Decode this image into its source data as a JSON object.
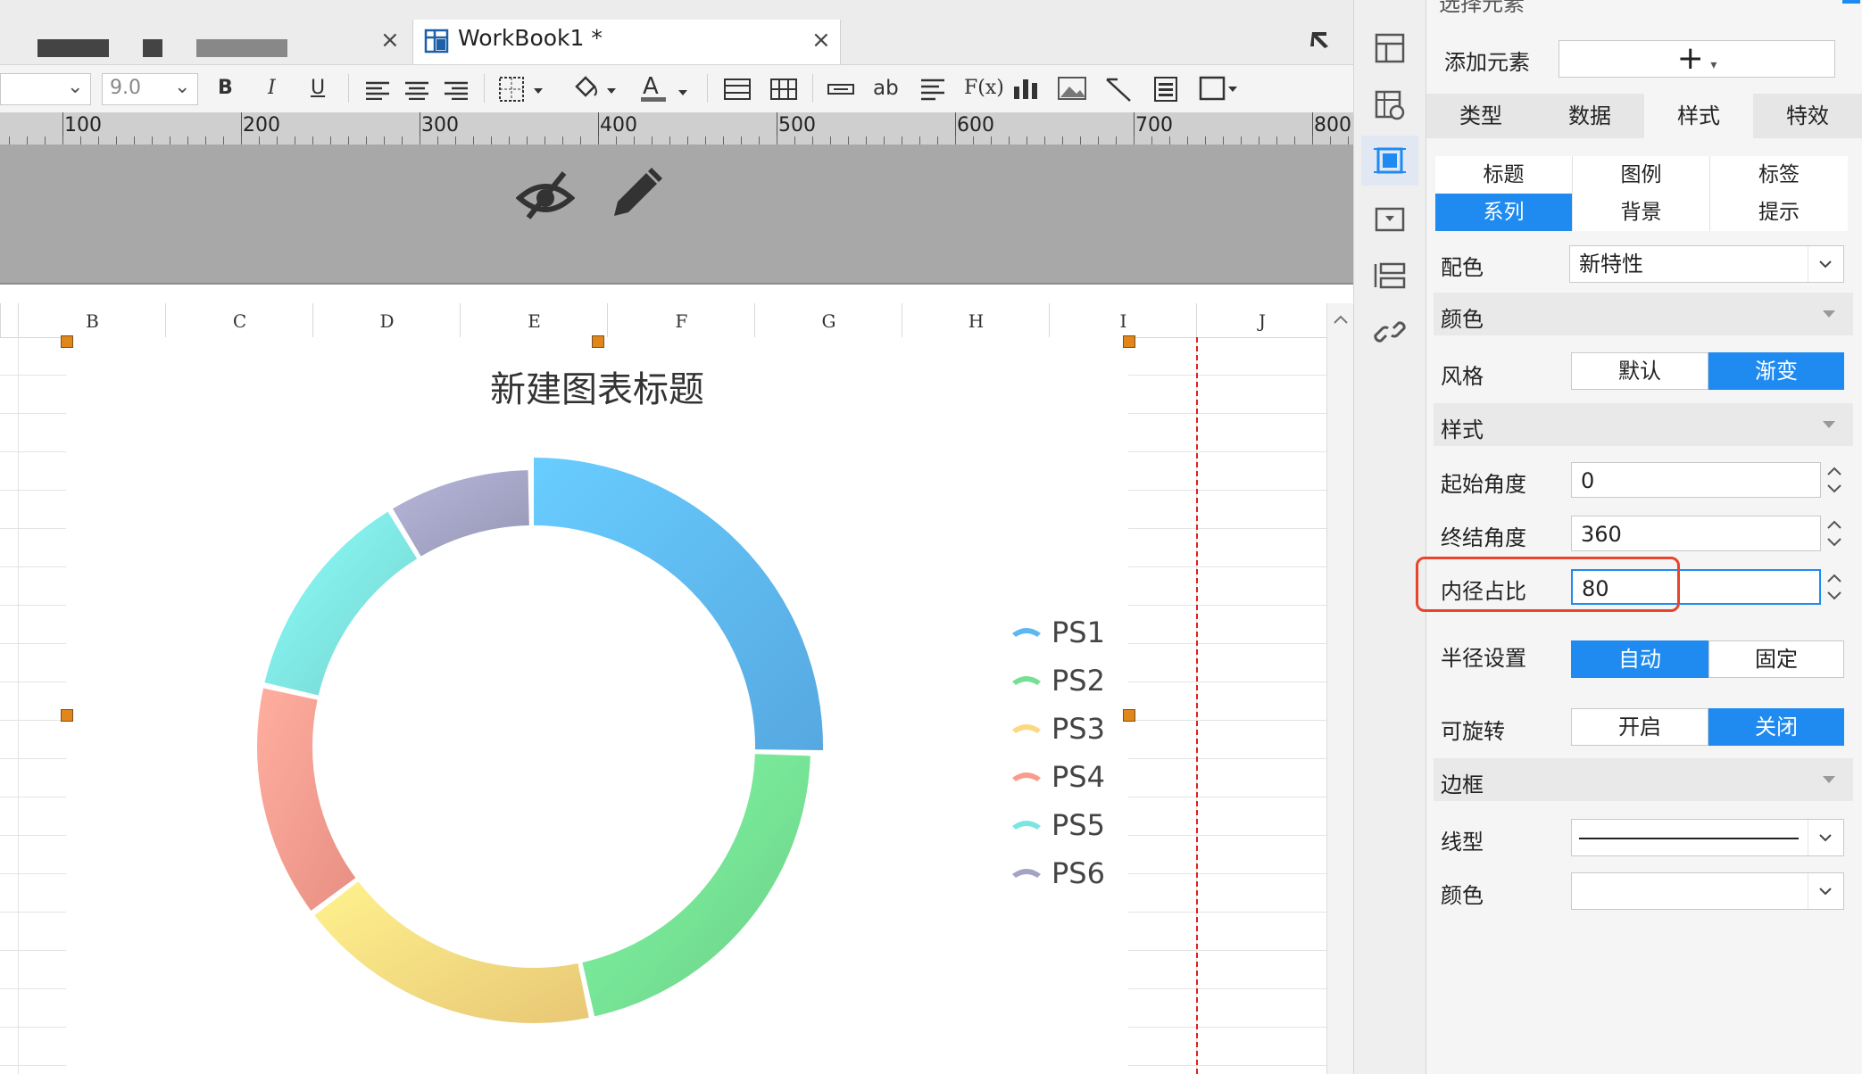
{
  "window": {
    "tabs": [
      {
        "title": "",
        "close": "×"
      },
      {
        "title": "WorkBook1  *",
        "close": "×"
      }
    ]
  },
  "toolbar": {
    "font_size": "9.0",
    "bold": "B",
    "italic": "I",
    "underline": "U",
    "text_btn": "ab",
    "formula_btn": "F(x)"
  },
  "ruler": {
    "labels": [
      "100",
      "200",
      "300",
      "400",
      "500",
      "600",
      "700",
      "800"
    ]
  },
  "sheet": {
    "columns": [
      "B",
      "C",
      "D",
      "E",
      "F",
      "G",
      "H",
      "I",
      "J"
    ]
  },
  "chart": {
    "title": "新建图表标题",
    "legend": [
      "PS1",
      "PS2",
      "PS3",
      "PS4",
      "PS5",
      "PS6"
    ]
  },
  "chart_data": {
    "type": "pie",
    "title": "新建图表标题",
    "inner_radius_ratio": 80,
    "start_angle": 0,
    "end_angle": 360,
    "legend_position": "right",
    "categories": [
      "PS1",
      "PS2",
      "PS3",
      "PS4",
      "PS5",
      "PS6"
    ],
    "values": [
      24,
      20,
      17,
      13,
      12,
      8
    ],
    "colors": [
      "#5db7f3",
      "#74e093",
      "#fcd87f",
      "#fb9b8e",
      "#7ee4e0",
      "#a3a3c4"
    ]
  },
  "panel": {
    "header_partial": "选择元素",
    "add_element_label": "添加元素",
    "add_element_btn": "+",
    "main_tabs": [
      "类型",
      "数据",
      "样式",
      "特效"
    ],
    "active_main_tab": "样式",
    "sub_tabs_row1": [
      "标题",
      "图例",
      "标签"
    ],
    "sub_tabs_row2": [
      "系列",
      "背景",
      "提示"
    ],
    "active_sub_tab": "系列",
    "palette_label": "配色",
    "palette_value": "新特性",
    "color_section": "颜色",
    "style_label": "风格",
    "style_options": [
      "默认",
      "渐变"
    ],
    "style_active": "渐变",
    "format_section": "样式",
    "start_angle_label": "起始角度",
    "start_angle_value": "0",
    "end_angle_label": "终结角度",
    "end_angle_value": "360",
    "inner_ratio_label": "内径占比",
    "inner_ratio_value": "80",
    "radius_label": "半径设置",
    "radius_options": [
      "自动",
      "固定"
    ],
    "radius_active": "自动",
    "rotate_label": "可旋转",
    "rotate_options": [
      "开启",
      "关闭"
    ],
    "rotate_active": "关闭",
    "border_section": "边框",
    "line_type_label": "线型",
    "border_color_label": "颜色",
    "highlight_color": "#e8442e",
    "accent_color": "#1f8bf0"
  }
}
